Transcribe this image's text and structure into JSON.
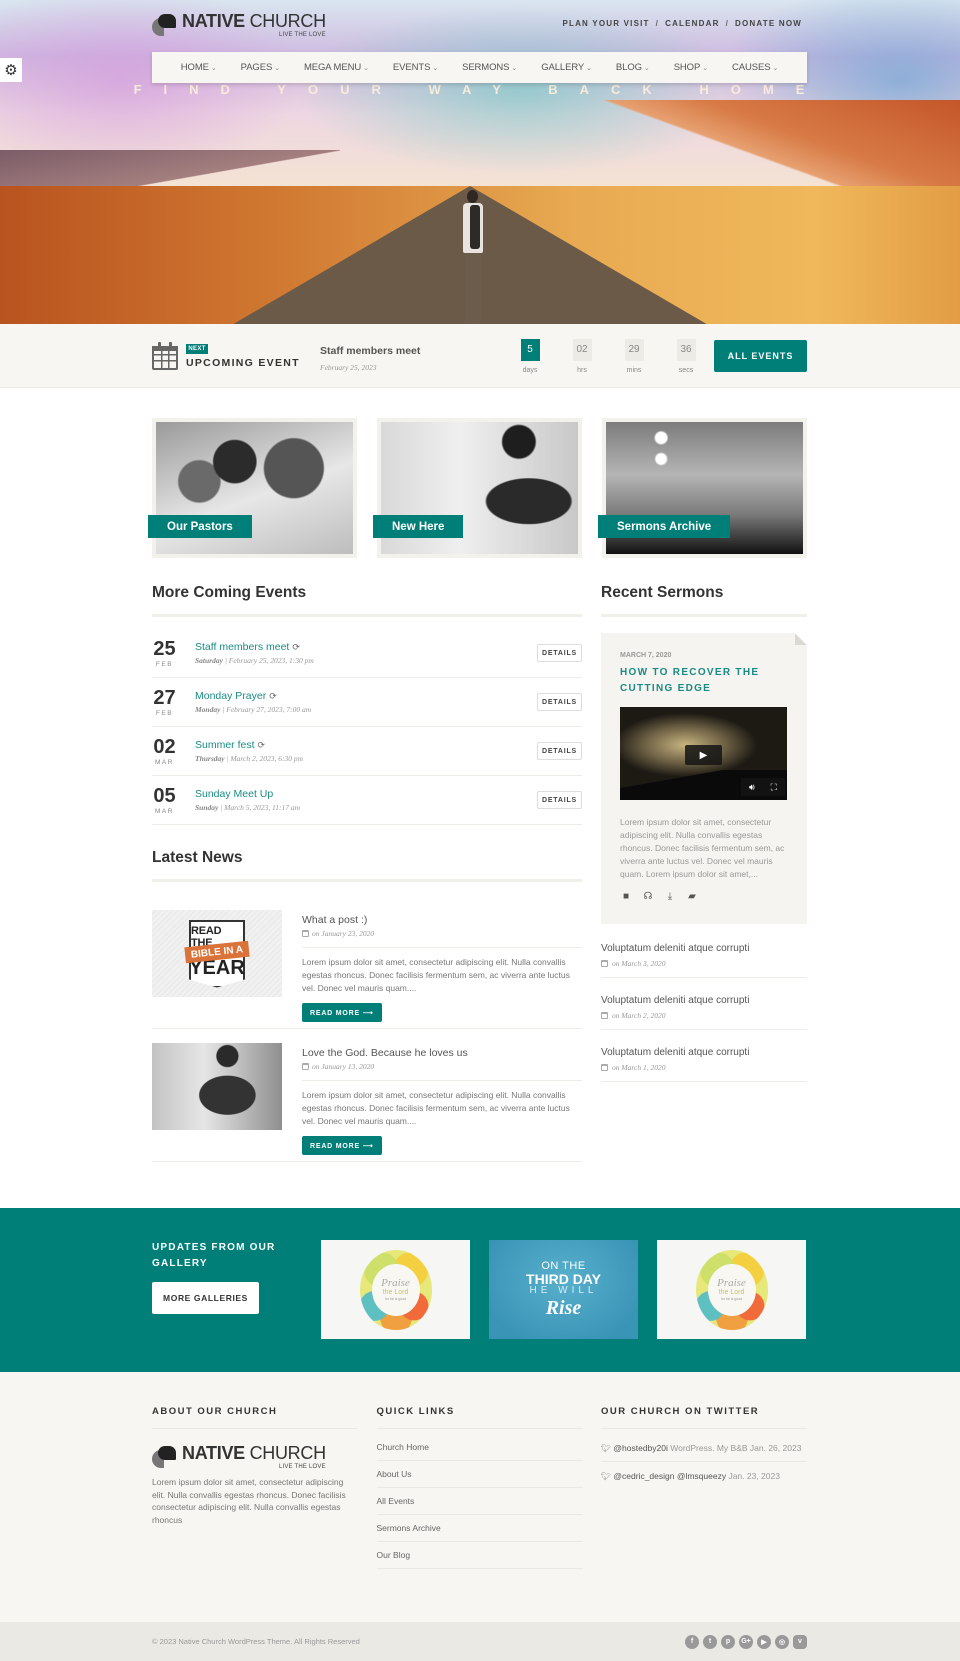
{
  "brand": {
    "name_bold": "NATIVE",
    "name_light": " CHURCH",
    "tagline": "LIVE THE LOVE"
  },
  "top_links": [
    "PLAN YOUR VISIT",
    "CALENDAR",
    "DONATE NOW"
  ],
  "top_link_separator": "/",
  "settings_icon": "gears-icon",
  "nav": {
    "items": [
      {
        "label": "HOME"
      },
      {
        "label": "PAGES"
      },
      {
        "label": "MEGA MENU"
      },
      {
        "label": "EVENTS"
      },
      {
        "label": "SERMONS"
      },
      {
        "label": "GALLERY"
      },
      {
        "label": "BLOG"
      },
      {
        "label": "SHOP"
      },
      {
        "label": "CAUSES"
      }
    ],
    "chevron": "⌄"
  },
  "hero": {
    "tagline": "FIND YOUR WAY BACK HOME"
  },
  "upcoming": {
    "badge": "NEXT",
    "title": "UPCOMING EVENT",
    "event_name": "Staff members meet",
    "event_date": "February 25, 2023",
    "countdown": [
      {
        "value": "5",
        "unit": "days"
      },
      {
        "value": "02",
        "unit": "hrs"
      },
      {
        "value": "29",
        "unit": "mins"
      },
      {
        "value": "36",
        "unit": "secs"
      }
    ],
    "button": "ALL EVENTS"
  },
  "features": [
    {
      "label": "Our Pastors"
    },
    {
      "label": "New Here"
    },
    {
      "label": "Sermons Archive"
    }
  ],
  "events_section": {
    "title": "More Coming Events",
    "details_label": "DETAILS",
    "items": [
      {
        "day": "25",
        "month": "FEB",
        "title": "Staff members meet",
        "recurring": true,
        "weekday": "Saturday",
        "datetime": "February 25, 2023,  1:30 pm"
      },
      {
        "day": "27",
        "month": "FEB",
        "title": "Monday Prayer",
        "recurring": true,
        "weekday": "Monday",
        "datetime": "February 27, 2023,  7:00 am"
      },
      {
        "day": "02",
        "month": "MAR",
        "title": "Summer fest",
        "recurring": true,
        "weekday": "Thursday",
        "datetime": "March 2, 2023,  6:30 pm"
      },
      {
        "day": "05",
        "month": "MAR",
        "title": "Sunday Meet Up",
        "recurring": false,
        "weekday": "Sunday",
        "datetime": "March 5, 2023,  11:17 am"
      }
    ]
  },
  "news_section": {
    "title": "Latest News",
    "read_more": "READ MORE ⟶",
    "posts": [
      {
        "title": "What a post :)",
        "date": "on January 23, 2020",
        "excerpt": "Lorem ipsum dolor sit amet, consectetur adipiscing elit. Nulla convallis egestas rhoncus. Donec facilisis fermentum sem, ac viverra ante luctus vel. Donec vel mauris quam....",
        "thumb_text": [
          "READ THE",
          "BIBLE IN A",
          "YEAR"
        ]
      },
      {
        "title": "Love the God. Because he loves us",
        "date": "on January 13, 2020",
        "excerpt": "Lorem ipsum dolor sit amet, consectetur adipiscing elit. Nulla convallis egestas rhoncus. Donec facilisis fermentum sem, ac viverra ante luctus vel. Donec vel mauris quam...."
      }
    ]
  },
  "sermons_section": {
    "title": "Recent Sermons",
    "featured": {
      "date": "MARCH 7, 2020",
      "title": "HOW TO RECOVER THE CUTTING EDGE",
      "excerpt": "Lorem ipsum dolor sit amet, consectetur adipiscing elit. Nulla convallis egestas rhoncus. Donec facilisis fermentum sem, ac viverra ante luctus vel. Donec vel mauris quam. Lorem ipsum dolor sit amet,...",
      "media_icons": [
        "video-icon",
        "headphones-icon",
        "download-icon",
        "book-icon"
      ]
    },
    "list": [
      {
        "title": "Voluptatum deleniti atque corrupti",
        "date": "on March 3, 2020"
      },
      {
        "title": "Voluptatum deleniti atque corrupti",
        "date": "on March 2, 2020"
      },
      {
        "title": "Voluptatum deleniti atque corrupti",
        "date": "on March 1, 2020"
      }
    ]
  },
  "gallery": {
    "title": "UPDATES FROM OUR GALLERY",
    "button": "MORE GALLERIES",
    "images": [
      {
        "type": "praise",
        "text": [
          "Praise",
          "the Lord",
          "for he is good"
        ]
      },
      {
        "type": "rise",
        "text": [
          "ON THE",
          "THIRD DAY",
          "HE WILL",
          "Rise"
        ]
      },
      {
        "type": "praise",
        "text": [
          "Praise",
          "the Lord",
          "for he is good"
        ]
      }
    ]
  },
  "footer": {
    "about": {
      "title": "ABOUT OUR CHURCH",
      "text": "Lorem ipsum dolor sit amet, consectetur adipiscing elit. Nulla convallis egestas rhoncus. Donec facilisis consectetur adipiscing elit. Nulla convallis egestas rhoncus"
    },
    "links": {
      "title": "QUICK LINKS",
      "items": [
        "Church Home",
        "About Us",
        "All Events",
        "Sermons Archive",
        "Our Blog"
      ]
    },
    "twitter": {
      "title": "OUR CHURCH ON TWITTER",
      "tweets": [
        {
          "handle": "@hostedby20i",
          "text": " WordPress. My B&B Jan. 26, 2023"
        },
        {
          "handle": "@cedric_design @lmsqueezy",
          "text": " Jan. 23, 2023"
        }
      ]
    },
    "copyright": "© 2023 Native Church WordPress Theme. All Rights Reserved",
    "socials": [
      {
        "name": "facebook",
        "glyph": "f"
      },
      {
        "name": "twitter",
        "glyph": "t"
      },
      {
        "name": "pinterest",
        "glyph": "p"
      },
      {
        "name": "google-plus",
        "glyph": "G+"
      },
      {
        "name": "youtube",
        "glyph": "▶"
      },
      {
        "name": "instagram",
        "glyph": "◎"
      },
      {
        "name": "vimeo",
        "glyph": "v"
      }
    ]
  },
  "colors": {
    "accent": "#007f78",
    "link": "#1a8b83",
    "footer_bg": "#f7f6f3",
    "copyright_bg": "#ebe9e4"
  }
}
